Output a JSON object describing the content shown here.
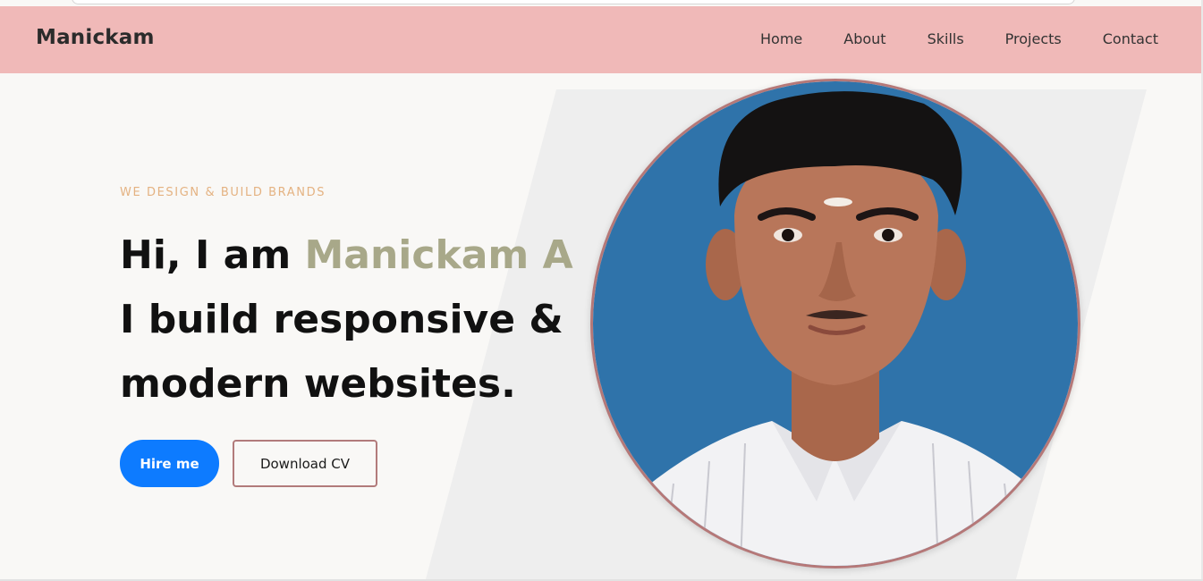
{
  "header": {
    "brand": "Manickam",
    "nav": [
      {
        "label": "Home"
      },
      {
        "label": "About"
      },
      {
        "label": "Skills"
      },
      {
        "label": "Projects"
      },
      {
        "label": "Contact"
      }
    ]
  },
  "hero": {
    "tagline": "WE DESIGN & BUILD BRANDS",
    "greeting": "Hi, I am ",
    "name": "Manickam A",
    "line2": "I build responsive &",
    "line3": "modern websites.",
    "hire_label": "Hire me",
    "cv_label": "Download CV"
  },
  "colors": {
    "navbar_bg": "#f0b9b8",
    "accent_name": "#a8a889",
    "tagline": "#e1a66d",
    "primary_button": "#0d7bff",
    "outline_button_border": "#b27b7b",
    "photo_border": "#b57878",
    "photo_background": "#2f73aa"
  },
  "icons": {
    "portrait": "profile-photo"
  }
}
